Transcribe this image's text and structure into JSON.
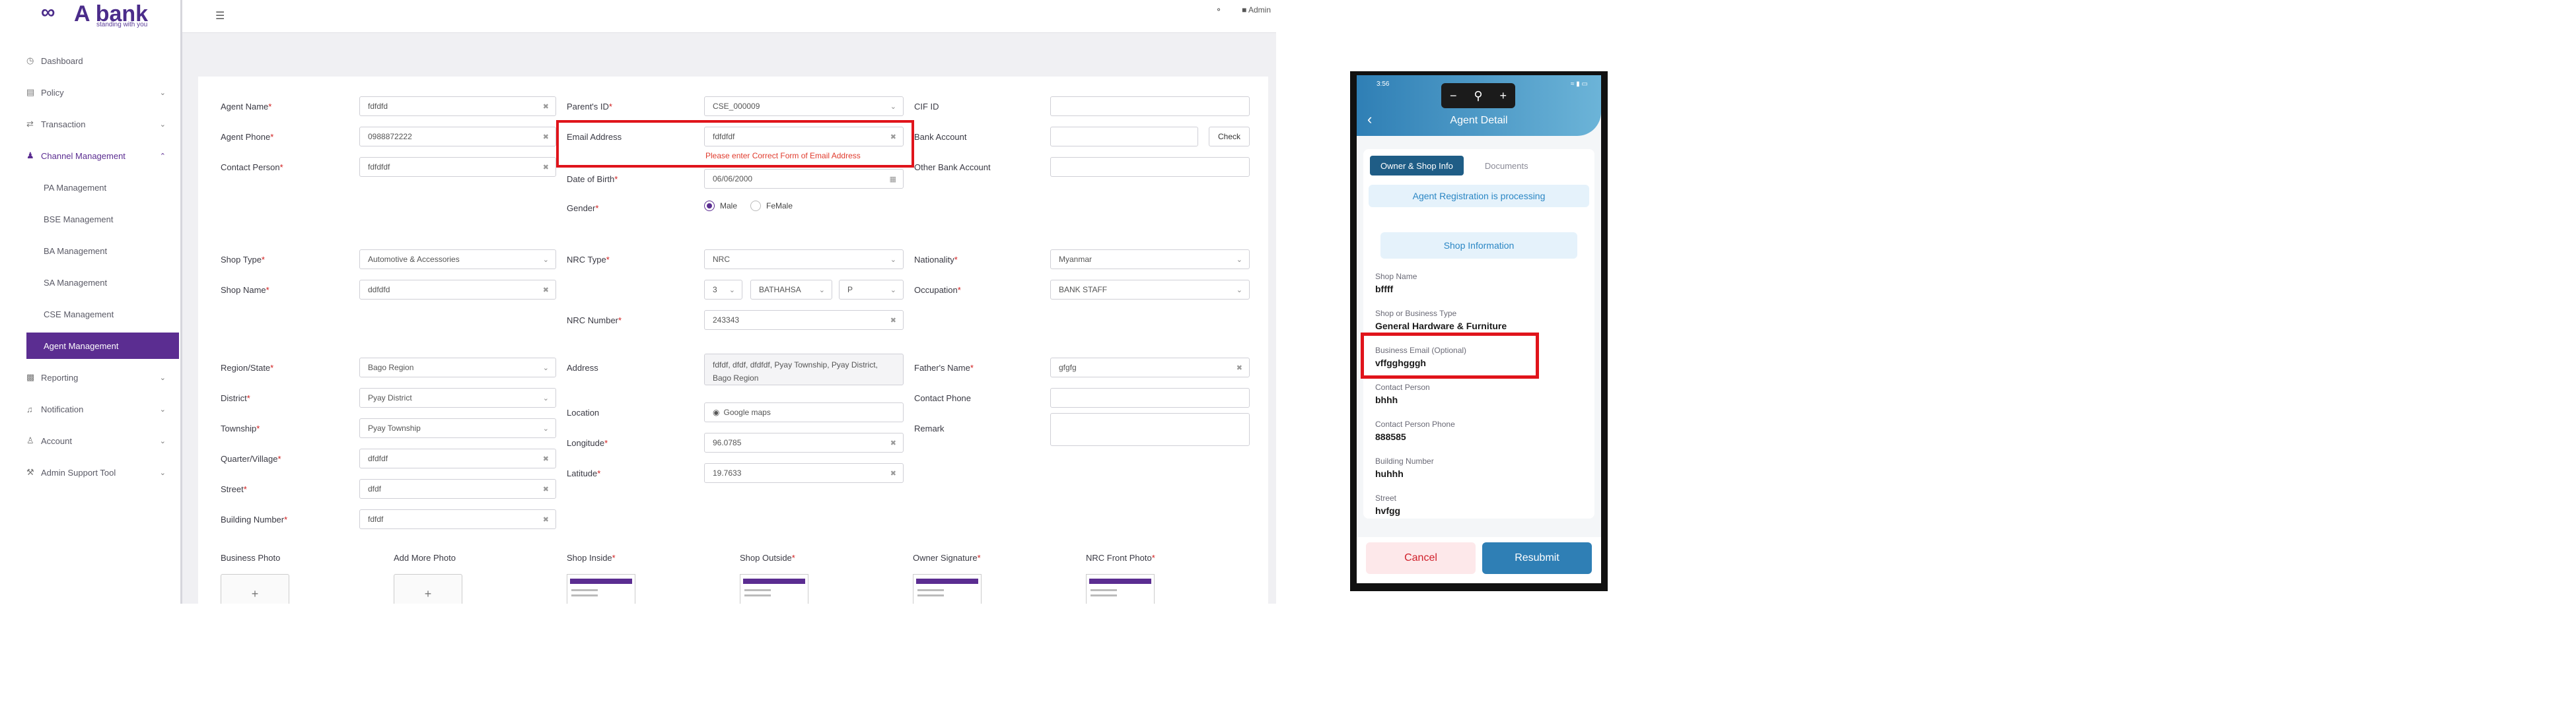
{
  "brand": {
    "name": "A bank",
    "tagline": "standing with you"
  },
  "sidebar": {
    "items": [
      {
        "label": "Dashboard",
        "icon": "clock-icon"
      },
      {
        "label": "Policy",
        "icon": "document-icon"
      },
      {
        "label": "Transaction",
        "icon": "transfer-icon"
      },
      {
        "label": "Channel Management",
        "icon": "people-icon"
      },
      {
        "label": "PA Management"
      },
      {
        "label": "BSE Management"
      },
      {
        "label": "BA Management"
      },
      {
        "label": "SA Management"
      },
      {
        "label": "CSE Management"
      },
      {
        "label": "Agent Management"
      },
      {
        "label": "Reporting",
        "icon": "bar-chart-icon"
      },
      {
        "label": "Notification",
        "icon": "bell-icon"
      },
      {
        "label": "Account",
        "icon": "user-icon"
      },
      {
        "label": "Admin Support Tool",
        "icon": "wrench-icon"
      }
    ],
    "active_item": "Agent Management",
    "accent_color": "#5b2d91"
  },
  "topbar": {
    "user": "Admin"
  },
  "form": {
    "agent_name": {
      "label": "Agent Name",
      "value": "fdfdfd"
    },
    "agent_phone": {
      "label": "Agent Phone",
      "value": "0988872222"
    },
    "contact_person": {
      "label": "Contact Person",
      "value": "fdfdfdf"
    },
    "parent_id": {
      "label": "Parent's ID",
      "value": "CSE_000009"
    },
    "email": {
      "label": "Email Address",
      "value": "fdfdfdf",
      "error": "Please enter Correct Form of Email Address"
    },
    "dob": {
      "label": "Date of Birth",
      "value": "06/06/2000"
    },
    "gender": {
      "label": "Gender",
      "options": [
        "Male",
        "FeMale"
      ],
      "selected": "Male"
    },
    "cif_id": {
      "label": "CIF ID",
      "value": ""
    },
    "bank_account": {
      "label": "Bank Account",
      "value": "",
      "button": "Check"
    },
    "other_bank_account": {
      "label": "Other Bank Account",
      "value": ""
    },
    "shop_type": {
      "label": "Shop Type",
      "value": "Automotive & Accessories"
    },
    "shop_name": {
      "label": "Shop Name",
      "value": "ddfdfd"
    },
    "nrc_type": {
      "label": "NRC Type",
      "value": "NRC"
    },
    "nrc_parts": [
      "3",
      "BATHAHSA",
      "P"
    ],
    "nrc_number": {
      "label": "NRC Number",
      "value": "243343"
    },
    "nationality": {
      "label": "Nationality",
      "value": "Myanmar"
    },
    "occupation": {
      "label": "Occupation",
      "value": "BANK STAFF"
    },
    "region": {
      "label": "Region/State",
      "value": "Bago Region"
    },
    "district": {
      "label": "District",
      "value": "Pyay District"
    },
    "township": {
      "label": "Township",
      "value": "Pyay Township"
    },
    "quarter": {
      "label": "Quarter/Village",
      "value": "dfdfdf"
    },
    "street": {
      "label": "Street",
      "value": "dfdf"
    },
    "building": {
      "label": "Building Number",
      "value": "fdfdf"
    },
    "address": {
      "label": "Address",
      "value": "fdfdf, dfdf, dfdfdf, Pyay Township, Pyay District, Bago Region"
    },
    "location": {
      "label": "Location",
      "value": "Google maps"
    },
    "longitude": {
      "label": "Longitude",
      "value": "96.0785"
    },
    "latitude": {
      "label": "Latitude",
      "value": "19.7633"
    },
    "father_name": {
      "label": "Father's Name",
      "value": "gfgfg"
    },
    "contact_phone": {
      "label": "Contact Phone",
      "value": ""
    },
    "remark": {
      "label": "Remark",
      "value": ""
    },
    "photos": [
      "Business Photo",
      "Add More Photo",
      "Shop Inside",
      "Shop Outside",
      "Owner Signature",
      "NRC Front Photo"
    ]
  },
  "mobile": {
    "status_time": "3:56",
    "title": "Agent Detail",
    "tabs": [
      "Owner & Shop Info",
      "Documents"
    ],
    "status_banner": "Agent Registration is processing",
    "section": "Shop Information",
    "fields": [
      {
        "label": "Shop Name",
        "value": "bffff"
      },
      {
        "label": "Shop or Business Type",
        "value": "General Hardware & Furniture"
      },
      {
        "label": "Business Email (Optional)",
        "value": "vffgghgggh"
      },
      {
        "label": "Contact Person",
        "value": "bhhh"
      },
      {
        "label": "Contact Person Phone",
        "value": "888585"
      },
      {
        "label": "Building Number",
        "value": "huhhh"
      },
      {
        "label": "Street",
        "value": "hvfgg"
      }
    ],
    "cancel": "Cancel",
    "resubmit": "Resubmit",
    "header_color": "#2f7fb5"
  },
  "highlight_color": "#e0141b"
}
